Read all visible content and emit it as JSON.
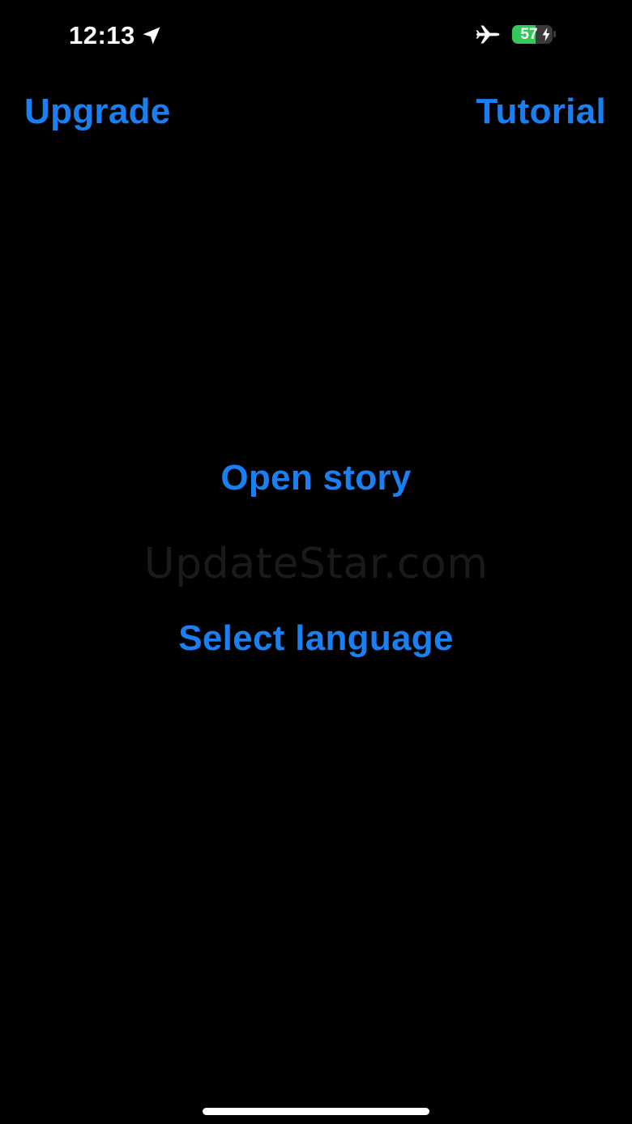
{
  "status_bar": {
    "time": "12:13",
    "location_icon": "location-arrow-icon",
    "airplane_icon": "airplane-icon",
    "battery_percent": 57,
    "battery_label": "57",
    "charging": true
  },
  "nav": {
    "upgrade_label": "Upgrade",
    "tutorial_label": "Tutorial"
  },
  "main": {
    "open_story_label": "Open story",
    "select_language_label": "Select language",
    "watermark": "UpdateStar.com"
  },
  "colors": {
    "background": "#000000",
    "accent": "#1a7ff0",
    "battery_fill": "#34c759"
  }
}
